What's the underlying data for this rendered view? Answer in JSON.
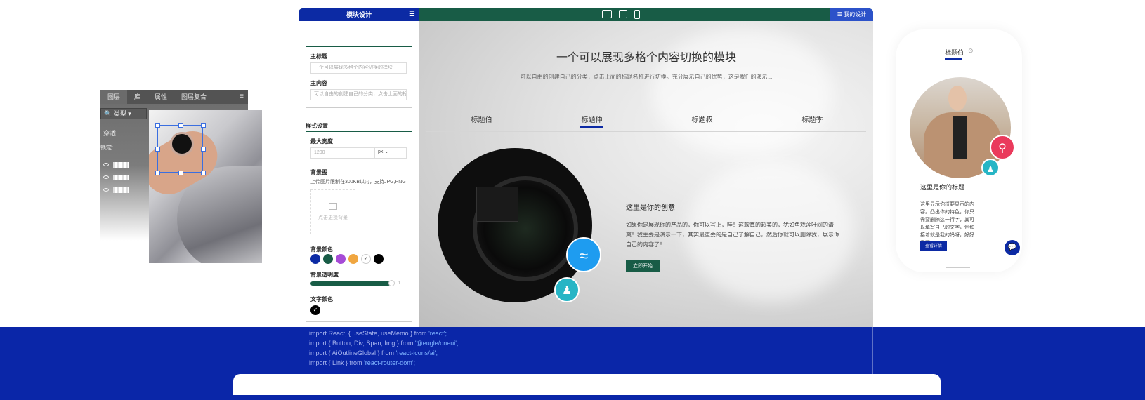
{
  "photoshop": {
    "tabs": [
      "图层",
      "库",
      "属性",
      "图层复合"
    ],
    "menu_icon": "≡",
    "filter_label": "类型",
    "blend_mode": "穿透",
    "lock_label": "锁定:"
  },
  "editor": {
    "header": {
      "title": "模块设计",
      "my_design": "我的设计"
    },
    "sidebar": {
      "main_title_label": "主标题",
      "main_title_value": "一个可以展现多格个内容切换的模块",
      "main_content_label": "主内容",
      "main_content_value": "可以自由的创建自己的分类，点击上面的标",
      "style_section": "样式设置",
      "max_width_label": "最大宽度",
      "max_width_placeholder": "1200",
      "max_width_unit": "px",
      "bg_image_label": "背景图",
      "bg_image_hint": "上传图片限制在300KB以内，支持JPG,PNG",
      "upload_label": "点击更换背景",
      "bg_color_label": "背景颜色",
      "bg_colors": [
        "#0c2aa4",
        "#185c46",
        "#a64bd6",
        "#f0a640",
        "#ffffff",
        "#000000"
      ],
      "bg_opacity_label": "背景透明度",
      "bg_opacity_value": "1",
      "text_color_label": "文字颜色"
    },
    "canvas": {
      "headline": "一个可以展现多格个内容切换的模块",
      "subtitle": "可以自由的创建自己的分类，点击上面的标题名称进行切换。充分展示自己的优势，这是我们的演示...",
      "tabs": [
        "标题伯",
        "标题仲",
        "标题叔",
        "标题季"
      ],
      "active_tab": 1,
      "idea_title": "这里是你的创意",
      "idea_body": "如果你是展现你的产品的，你可以写上，哇！这款真的超美的，犹如鱼戏莲叶间的清爽！我主要是演示一下，其实最重要的是自己了解自己，然后你就可以删除我，展示你自己的内容了！",
      "start_button": "立即开始"
    }
  },
  "code": {
    "lines": [
      {
        "code": "import React, { useState, useMemo } from ",
        "str": "'react';"
      },
      {
        "code": "import { Button, Div, Span, Img } from ",
        "str": "'@eugle/oneui';"
      },
      {
        "code": "import { AiOutlineGlobal } from ",
        "str": "'react-icons/ai';"
      },
      {
        "code": "import { Link } from ",
        "str": "'react-router-dom';"
      }
    ]
  },
  "mobile": {
    "tab_label": "标题伯",
    "more_icon": "⊙",
    "title": "这里是你的标题",
    "body": "这里显示你将要显示的内容。凸出你的特色，你只需要删除这一行字，其可以填写自己的文字，例如接着就是我的妈呀，好好看哦。",
    "button": "查看详情"
  }
}
